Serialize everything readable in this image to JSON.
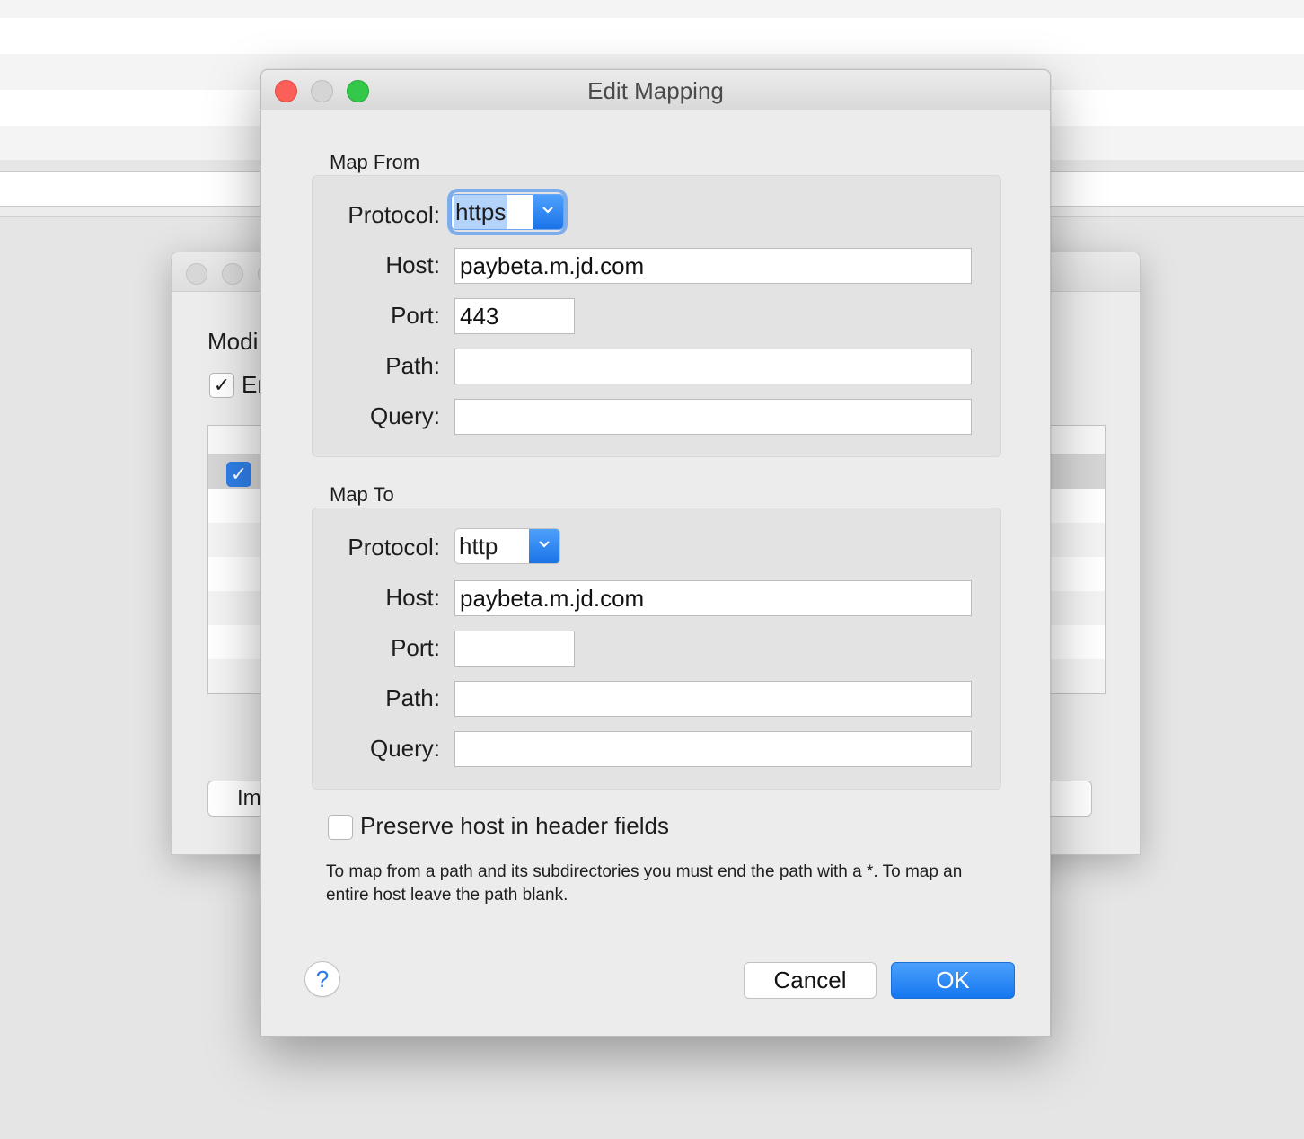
{
  "background": {
    "heading": "Modi",
    "checkbox_label": "Er",
    "button_label": "Im"
  },
  "dialog": {
    "title": "Edit Mapping",
    "map_from": {
      "section_label": "Map From",
      "protocol_label": "Protocol:",
      "protocol_value": "https",
      "host_label": "Host:",
      "host_value": "paybeta.m.jd.com",
      "port_label": "Port:",
      "port_value": "443",
      "path_label": "Path:",
      "path_value": "",
      "query_label": "Query:",
      "query_value": ""
    },
    "map_to": {
      "section_label": "Map To",
      "protocol_label": "Protocol:",
      "protocol_value": "http",
      "host_label": "Host:",
      "host_value": "paybeta.m.jd.com",
      "port_label": "Port:",
      "port_value": "",
      "path_label": "Path:",
      "path_value": "",
      "query_label": "Query:",
      "query_value": ""
    },
    "preserve_host_label": "Preserve host in header fields",
    "preserve_host_checked": false,
    "note": "To map from a path and its subdirectories you must end the path with a *. To map an entire host leave the path blank.",
    "help_label": "?",
    "cancel_label": "Cancel",
    "ok_label": "OK"
  },
  "colors": {
    "accent": "#1677f0",
    "close": "#fc5f57",
    "maximize": "#34c84a"
  }
}
